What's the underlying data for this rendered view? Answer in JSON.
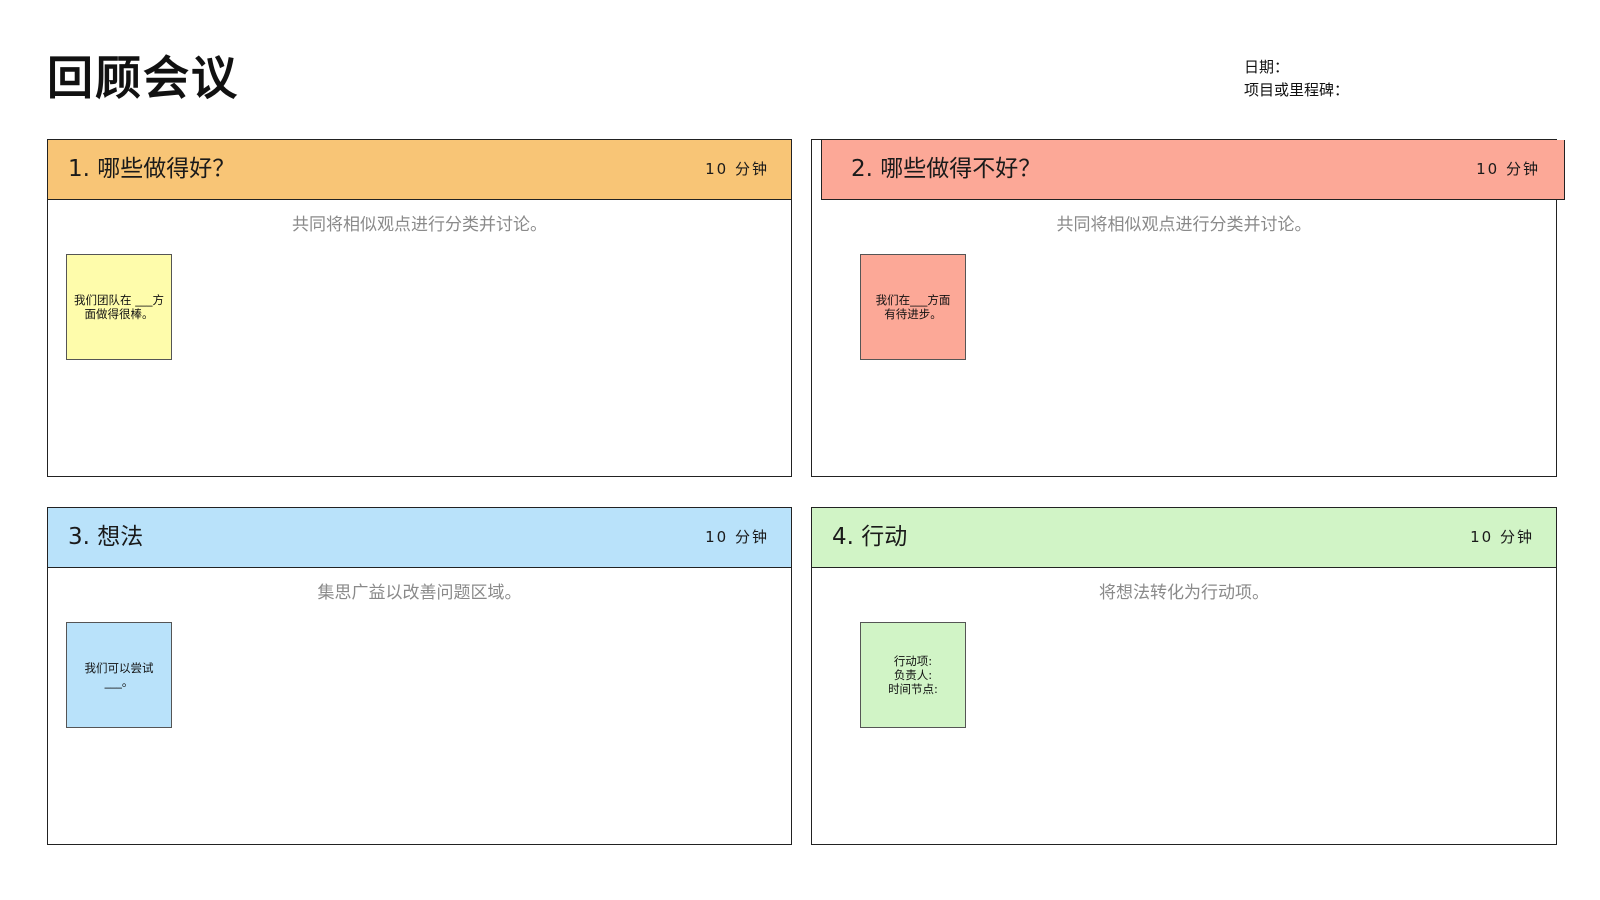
{
  "page": {
    "title": "回顾会议",
    "date_label": "日期：",
    "project_label": "项目或里程碑："
  },
  "colors": {
    "panel1_header": "#f8c576",
    "panel1_sticky": "#fefcab",
    "panel2_header": "#fca897",
    "panel2_sticky": "#fca897",
    "panel3_header": "#b9e2fa",
    "panel3_sticky": "#b9e2fa",
    "panel4_header": "#d1f4c6",
    "panel4_sticky": "#d1f4c6",
    "hint_text": "#8a8a8a",
    "border": "#222222"
  },
  "panels": [
    {
      "title": "1. 哪些做得好？",
      "time": "10 分钟",
      "hint": "共同将相似观点进行分类并讨论。",
      "sticky": "我们团队在 ___方\n面做得很棒。"
    },
    {
      "title": "2. 哪些做得不好？",
      "time": "10 分钟",
      "hint": "共同将相似观点进行分类并讨论。",
      "sticky": "我们在___方面\n有待进步。"
    },
    {
      "title": "3. 想法",
      "time": "10 分钟",
      "hint": "集思广益以改善问题区域。",
      "sticky": "我们可以尝试\n___。"
    },
    {
      "title": "4. 行动",
      "time": "10 分钟",
      "hint": "将想法转化为行动项。",
      "sticky": "行动项:\n负责人:\n时间节点:"
    }
  ]
}
